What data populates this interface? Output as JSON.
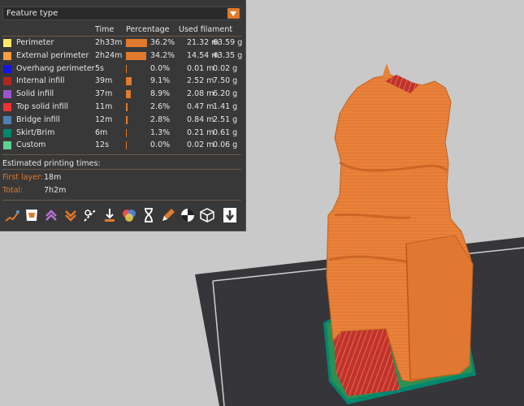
{
  "legend": {
    "dropdown_value": "Feature type",
    "headers": {
      "time": "Time",
      "percentage": "Percentage",
      "used_filament": "Used filament"
    },
    "rows": [
      {
        "name": "Perimeter",
        "time": "2h33m",
        "pct": "36.2%",
        "pct_value": 36.2,
        "meters": "21.32 m",
        "grams": "63.59 g",
        "color": "#ffe96b"
      },
      {
        "name": "External perimeter",
        "time": "2h24m",
        "pct": "34.2%",
        "pct_value": 34.2,
        "meters": "14.54 m",
        "grams": "43.35 g",
        "color": "#ff9c3b"
      },
      {
        "name": "Overhang perimeter",
        "time": "5s",
        "pct": "0.0%",
        "pct_value": 0.0,
        "meters": "0.01 m",
        "grams": "0.02 g",
        "color": "#1414e6"
      },
      {
        "name": "Internal infill",
        "time": "39m",
        "pct": "9.1%",
        "pct_value": 9.1,
        "meters": "2.52 m",
        "grams": "7.50 g",
        "color": "#b3261e"
      },
      {
        "name": "Solid infill",
        "time": "37m",
        "pct": "8.9%",
        "pct_value": 8.9,
        "meters": "2.08 m",
        "grams": "6.20 g",
        "color": "#9b54cc"
      },
      {
        "name": "Top solid infill",
        "time": "11m",
        "pct": "2.6%",
        "pct_value": 2.6,
        "meters": "0.47 m",
        "grams": "1.41 g",
        "color": "#f03232"
      },
      {
        "name": "Bridge infill",
        "time": "12m",
        "pct": "2.8%",
        "pct_value": 2.8,
        "meters": "0.84 m",
        "grams": "2.51 g",
        "color": "#4d80b3"
      },
      {
        "name": "Skirt/Brim",
        "time": "6m",
        "pct": "1.3%",
        "pct_value": 1.3,
        "meters": "0.21 m",
        "grams": "0.61 g",
        "color": "#00876e"
      },
      {
        "name": "Custom",
        "time": "12s",
        "pct": "0.0%",
        "pct_value": 0.0,
        "meters": "0.02 m",
        "grams": "0.06 g",
        "color": "#5ed194"
      }
    ],
    "estimated_title": "Estimated printing times:",
    "first_layer_label": "First layer:",
    "first_layer_value": "18m",
    "total_label": "Total:",
    "total_value": "7h2m"
  },
  "toolbar": [
    "travel-icon",
    "wipe-icon",
    "retractions-icon",
    "deretractions-icon",
    "seams-icon",
    "tool-changes-icon",
    "color-changes-icon",
    "pause-prints-icon",
    "custom-gcodes-icon",
    "center-of-gravity-icon",
    "shells-icon",
    "tool-marker-icon"
  ],
  "colors": {
    "accent": "#e07a2c",
    "panel_bg": "#383838",
    "viewport_bg": "#c9c9c9",
    "bed": "#36363a",
    "model_orange": "#e8813a"
  }
}
